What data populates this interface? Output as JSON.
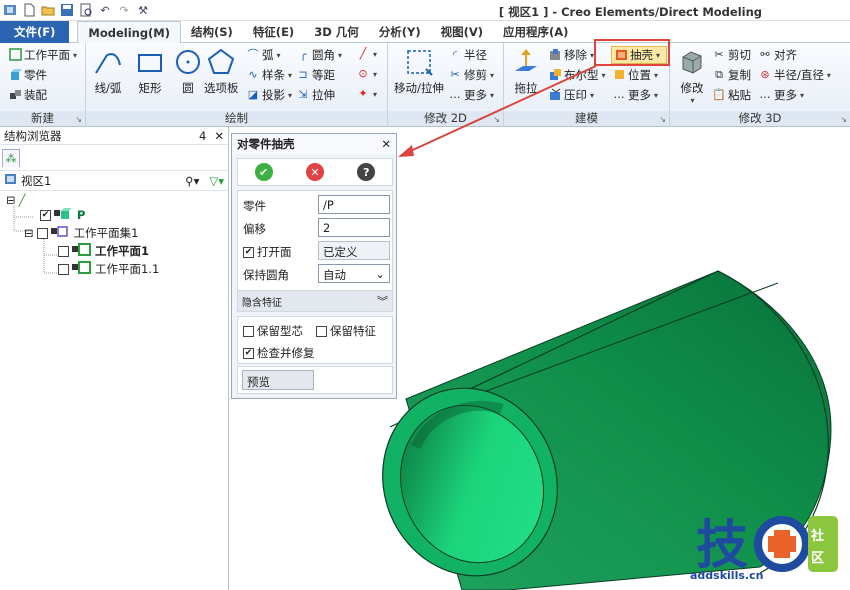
{
  "window": {
    "title": "[ 视区1 ] - Creo Elements/Direct Modeling",
    "quick_access": [
      "new-icon",
      "open-icon",
      "save-icon",
      "print-preview-icon",
      "undo-icon",
      "redo-icon",
      "customize-icon"
    ]
  },
  "tabs": [
    {
      "label": "文件(F)"
    },
    {
      "label": "Modeling(M)"
    },
    {
      "label": "结构(S)"
    },
    {
      "label": "特征(E)"
    },
    {
      "label": "3D 几何"
    },
    {
      "label": "分析(Y)"
    },
    {
      "label": "视图(V)"
    },
    {
      "label": "应用程序(A)"
    }
  ],
  "ribbon": {
    "new_group": {
      "label": "新建",
      "items": [
        "工作平面",
        "零件",
        "装配"
      ]
    },
    "draw_group": {
      "label": "绘制",
      "big": [
        "线/弧",
        "矩形",
        "圆",
        "选项板"
      ],
      "small_col1": [
        "弧",
        "样条",
        "投影"
      ],
      "small_col2": [
        "圆角",
        "等距",
        "拉伸"
      ]
    },
    "modify2d_group": {
      "label": "修改 2D",
      "big": "移动/拉伸",
      "small": [
        "半径",
        "修剪",
        "更多"
      ]
    },
    "build_group": {
      "label": "建模",
      "big": "拖拉",
      "small_col1": [
        "移除",
        "布尔型",
        "压印"
      ],
      "shell": "抽壳",
      "small_col2": [
        "位置",
        "更多"
      ]
    },
    "modify3d_group": {
      "label": "修改 3D",
      "big": "修改",
      "small_col1": [
        "剪切",
        "复制",
        "粘贴"
      ],
      "small_col2": [
        "对齐",
        "半径/直径",
        "更多"
      ]
    }
  },
  "browser": {
    "title": "结构浏览器",
    "pin": "4",
    "view_label": "视区1",
    "tree": [
      {
        "label": "P",
        "level": 1,
        "checked": true
      },
      {
        "label": "工作平面集1",
        "level": 1,
        "checked": false
      },
      {
        "label": "工作平面1",
        "level": 2,
        "checked": false
      },
      {
        "label": "工作平面1.1",
        "level": 2,
        "checked": false
      }
    ]
  },
  "dialog": {
    "title": "对零件抽壳",
    "part_label": "零件",
    "part_value": "/P",
    "offset_label": "偏移",
    "offset_value": "2",
    "open_face_label": "打开面",
    "open_face_value": "已定义",
    "keep_fillet_label": "保持圆角",
    "keep_fillet_value": "自动",
    "hidden_features_label": "隐含特征",
    "keep_core_label": "保留型芯",
    "keep_features_label": "保留特征",
    "check_repair_label": "检查并修复",
    "preview_label": "预览"
  },
  "watermark": {
    "text_main": "技",
    "text_badge": "社区",
    "url": "addskills.cn"
  },
  "colors": {
    "accent": "#2b64b0",
    "shell_green": "#1fa35f",
    "highlight_red": "#e0443c"
  }
}
